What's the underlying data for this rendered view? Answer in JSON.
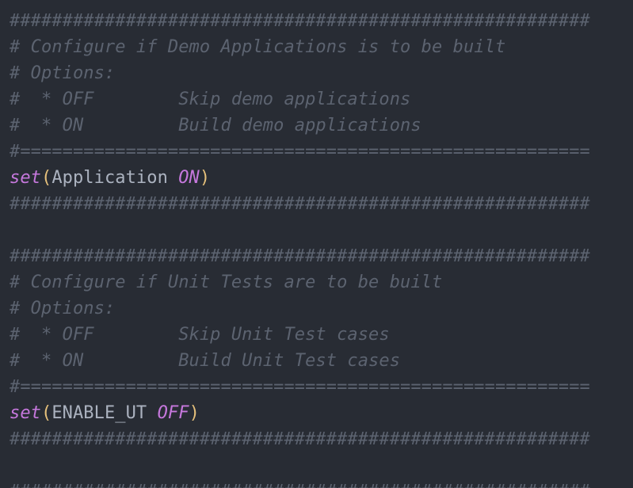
{
  "colors": {
    "background": "#282c34",
    "comment": "#5c6370",
    "keyword": "#c678dd",
    "paren": "#e5c07b",
    "identifier": "#abb2bf"
  },
  "code": {
    "block1": {
      "hash_top": "#######################################################",
      "title": "# Configure if Demo Applications is to be built",
      "options": "# Options:",
      "opt_off": "#  * OFF        Skip demo applications",
      "opt_on": "#  * ON         Build demo applications",
      "separator": "#======================================================",
      "cmd": "set",
      "open_paren": "(",
      "arg_name": "Application ",
      "arg_value": "ON",
      "close_paren": ")",
      "hash_bottom": "#######################################################"
    },
    "block2": {
      "hash_top": "#######################################################",
      "title": "# Configure if Unit Tests are to be built",
      "options": "# Options:",
      "opt_off": "#  * OFF        Skip Unit Test cases",
      "opt_on": "#  * ON         Build Unit Test cases",
      "separator": "#======================================================",
      "cmd": "set",
      "open_paren": "(",
      "arg_name": "ENABLE_UT ",
      "arg_value": "OFF",
      "close_paren": ")",
      "hash_bottom": "#######################################################"
    },
    "block3": {
      "hash_top": "#######################################################"
    }
  }
}
